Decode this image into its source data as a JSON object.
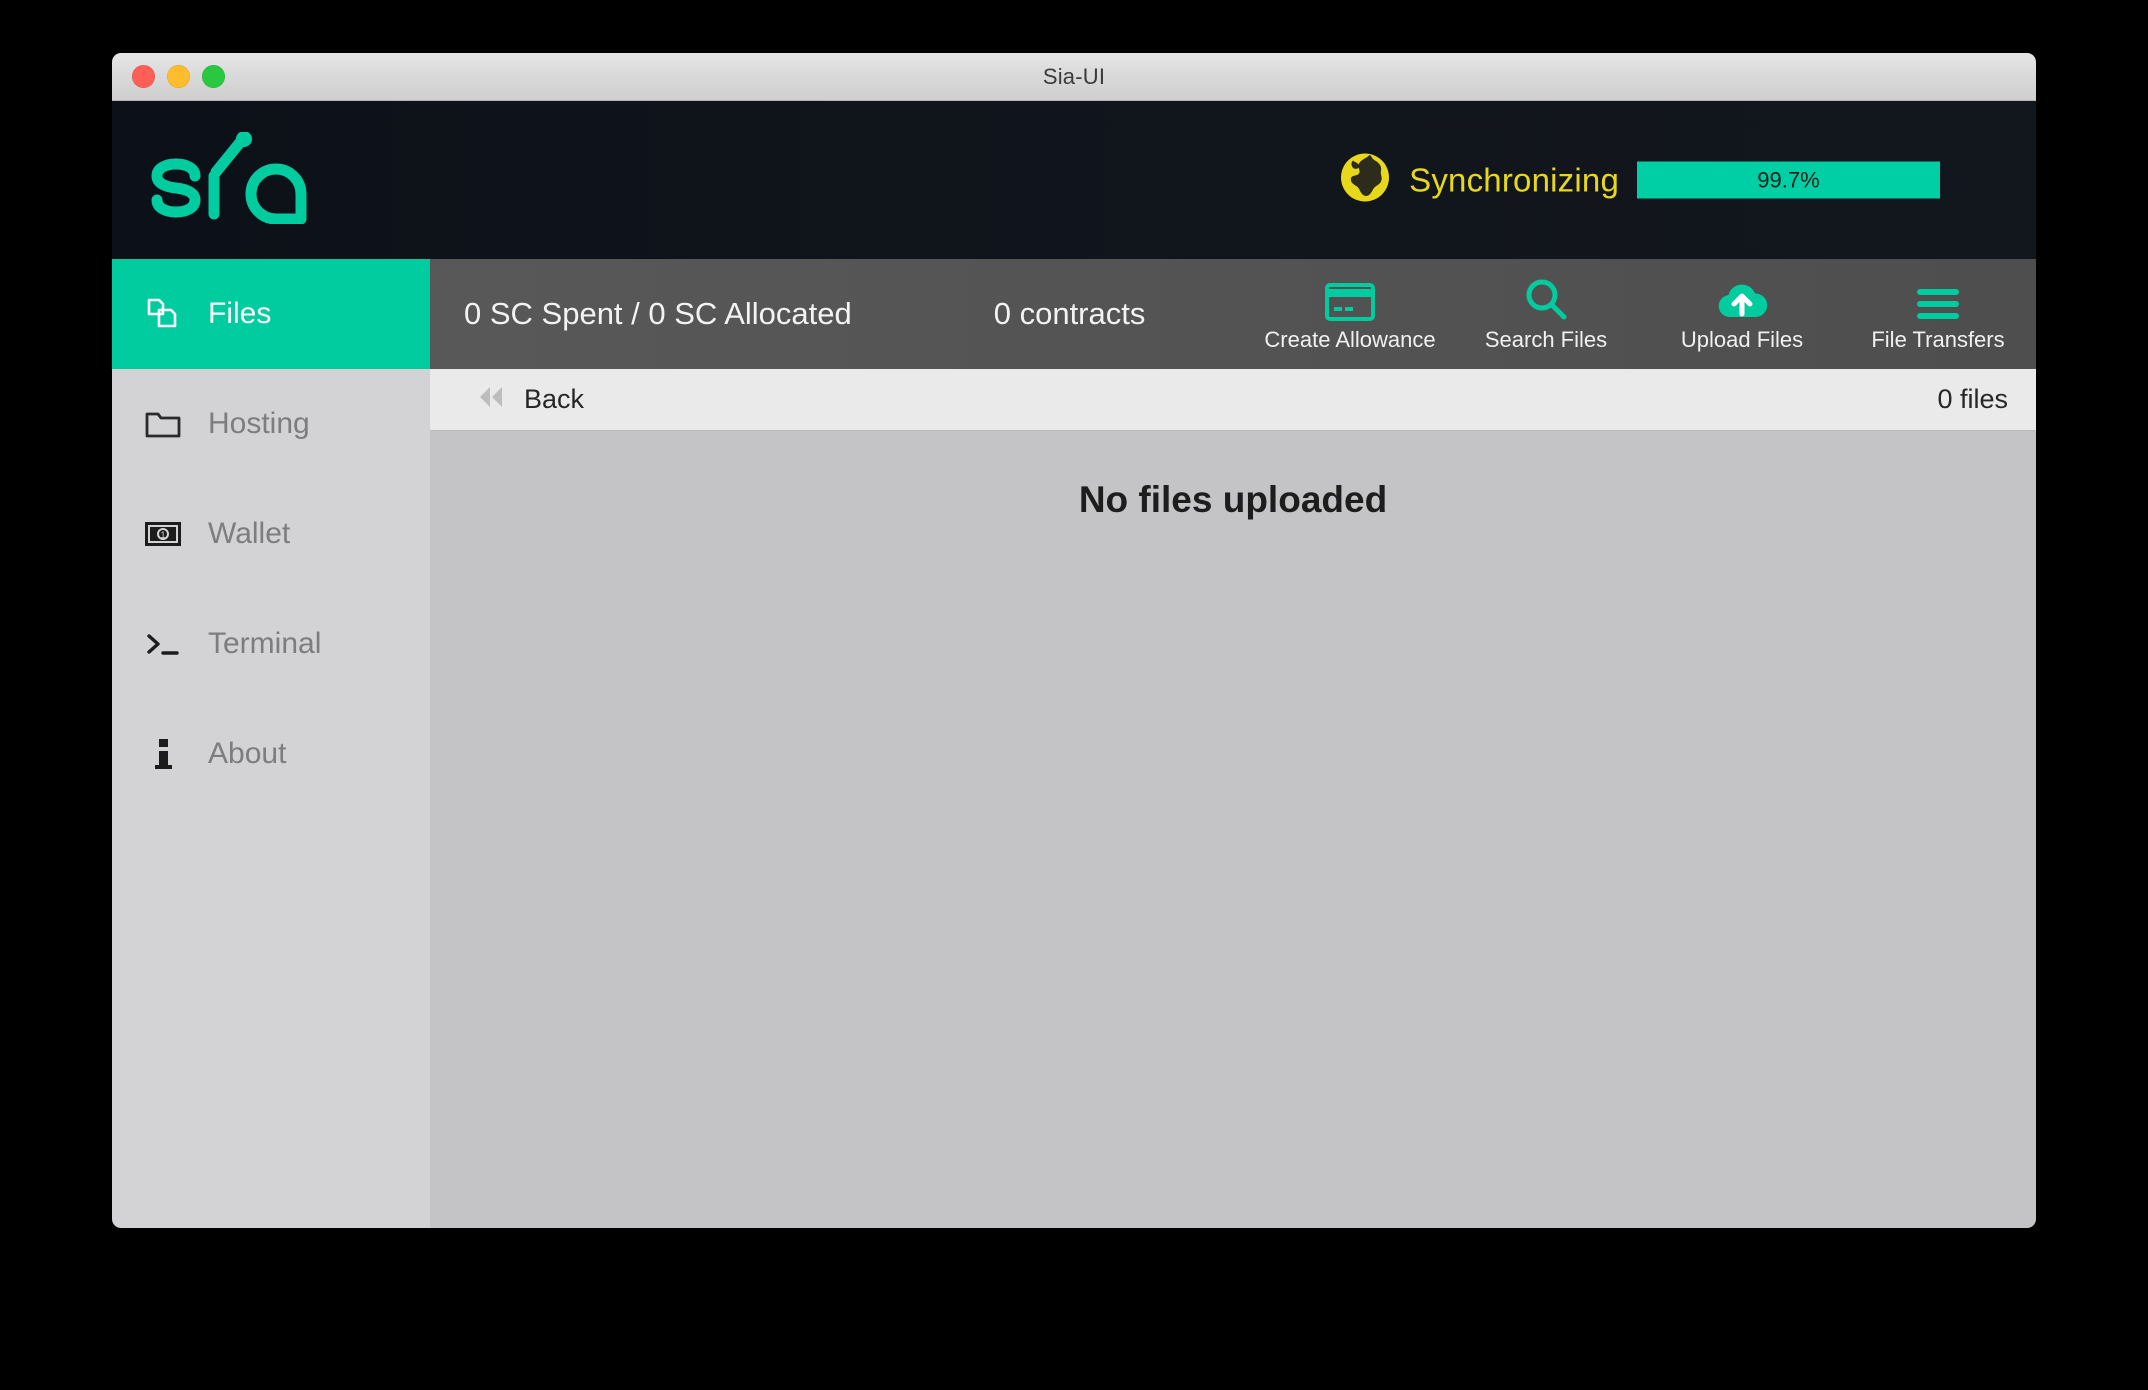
{
  "window": {
    "title": "Sia-UI",
    "traffic_lights": [
      {
        "name": "close",
        "color": "#ff5f57"
      },
      {
        "name": "minimize",
        "color": "#ffbd2e"
      },
      {
        "name": "zoom",
        "color": "#2ac840"
      }
    ]
  },
  "header": {
    "logo_text": "sia",
    "logo_color": "#00cc9f",
    "background": "#11151c",
    "sync": {
      "icon": "globe-icon",
      "icon_color": "#e8d81c",
      "label": "Synchronizing",
      "label_color": "#e8d81c",
      "progress_percent": 99.7,
      "progress_text": "99.7%",
      "progress_color": "#00cfa5"
    }
  },
  "sidebar": {
    "background": "#d3d3d6",
    "active_color": "#00cc9f",
    "items": [
      {
        "label": "Files",
        "icon": "files-icon",
        "active": true
      },
      {
        "label": "Hosting",
        "icon": "folder-icon",
        "active": false
      },
      {
        "label": "Wallet",
        "icon": "banknote-icon",
        "active": false
      },
      {
        "label": "Terminal",
        "icon": "prompt-icon",
        "active": false
      },
      {
        "label": "About",
        "icon": "info-icon",
        "active": false
      }
    ]
  },
  "toolbar": {
    "background": "#525252",
    "accent": "#00cc9f",
    "spent_allocated": "0 SC Spent / 0 SC Allocated",
    "contracts": "0 contracts",
    "actions": [
      {
        "label": "Create Allowance",
        "icon": "credit-card-icon"
      },
      {
        "label": "Search Files",
        "icon": "search-icon"
      },
      {
        "label": "Upload Files",
        "icon": "cloud-upload-icon"
      },
      {
        "label": "File Transfers",
        "icon": "hamburger-menu-icon"
      }
    ]
  },
  "backbar": {
    "back_label": "Back",
    "back_icon": "double-chevron-left-icon",
    "file_count": "0 files"
  },
  "main": {
    "background": "#c4c4c6",
    "empty_message": "No files uploaded"
  }
}
